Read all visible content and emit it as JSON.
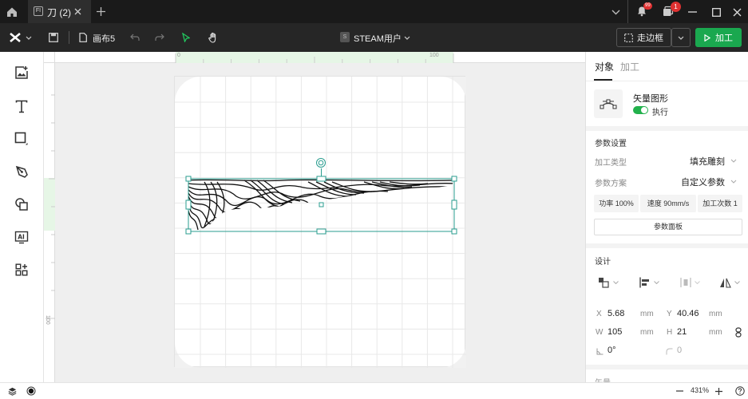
{
  "titlebar": {
    "tab_label": "刀 (2)",
    "tab_badge": "FI",
    "notif_count": "99",
    "msg_count": "1"
  },
  "toolbar": {
    "canvas_name": "画布5",
    "user_label": "STEAM用户",
    "user_badge": "S",
    "frame_label": "走边框",
    "process_label": "加工"
  },
  "ruler": {
    "t0": "0",
    "t100": "100",
    "l100": "100"
  },
  "panel": {
    "tab_object": "对象",
    "tab_process": "加工",
    "object_type": "矢量图形",
    "execute_label": "执行",
    "param_section": "参数设置",
    "process_type_label": "加工类型",
    "process_type_value": "填充雕刻",
    "param_scheme_label": "参数方案",
    "param_scheme_value": "自定义参数",
    "power": "功率 100%",
    "speed": "速度 90mm/s",
    "passes": "加工次数 1",
    "param_panel_button": "参数面板",
    "design_section": "设计",
    "x_label": "X",
    "x_value": "5.68",
    "x_unit": "mm",
    "y_label": "Y",
    "y_value": "40.46",
    "y_unit": "mm",
    "w_label": "W",
    "w_value": "105",
    "w_unit": "mm",
    "h_label": "H",
    "h_value": "21",
    "h_unit": "mm",
    "rotate_value": "0°",
    "corner_value": "0",
    "next_section": "矢量"
  },
  "status": {
    "zoom": "431%"
  }
}
